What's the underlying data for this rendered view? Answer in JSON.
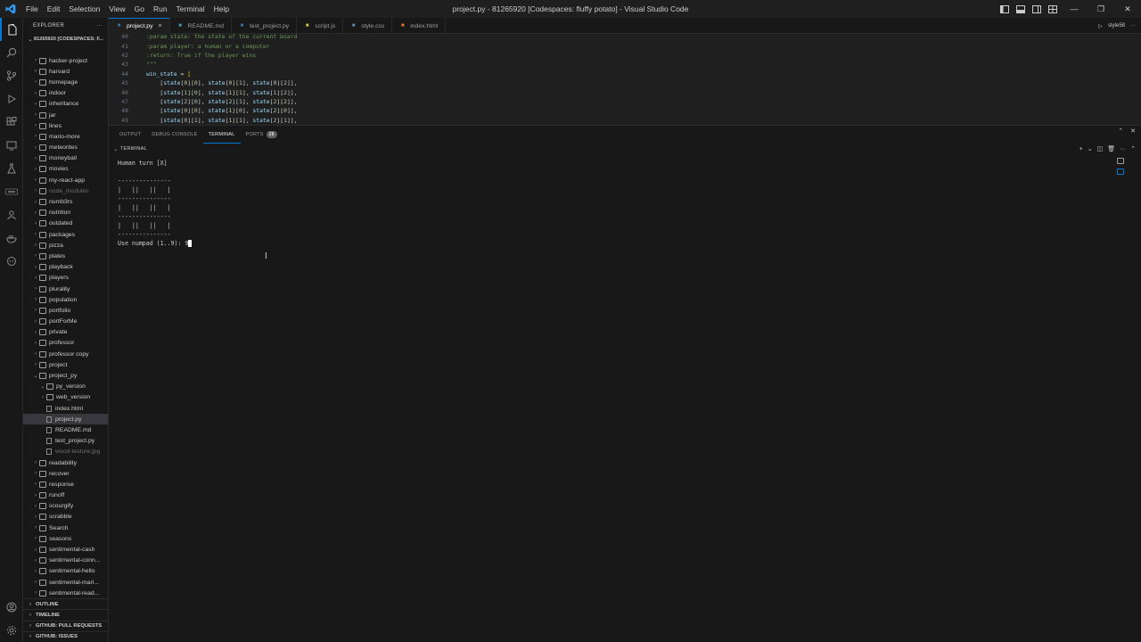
{
  "titlebar": {
    "menu": [
      "File",
      "Edit",
      "Selection",
      "View",
      "Go",
      "Run",
      "Terminal",
      "Help"
    ],
    "title": "project.py - 81265920 [Codespaces: fluffy potato] - Visual Studio Code"
  },
  "sidebar": {
    "header": "EXPLORER",
    "root": "81265920 [CODESPACES: F...",
    "items": [
      {
        "label": "hacker-project",
        "type": "folder",
        "depth": 0,
        "open": false
      },
      {
        "label": "harvard",
        "type": "folder",
        "depth": 0,
        "open": false
      },
      {
        "label": "homepage",
        "type": "folder",
        "depth": 0,
        "open": false
      },
      {
        "label": "indoor",
        "type": "folder",
        "depth": 0,
        "open": false
      },
      {
        "label": "inheritance",
        "type": "folder",
        "depth": 0,
        "open": false
      },
      {
        "label": "jar",
        "type": "folder",
        "depth": 0,
        "open": false
      },
      {
        "label": "lines",
        "type": "folder",
        "depth": 0,
        "open": false
      },
      {
        "label": "mario-more",
        "type": "folder",
        "depth": 0,
        "open": false
      },
      {
        "label": "meteorites",
        "type": "folder",
        "depth": 0,
        "open": false
      },
      {
        "label": "moneyball",
        "type": "folder",
        "depth": 0,
        "open": false
      },
      {
        "label": "movies",
        "type": "folder",
        "depth": 0,
        "open": false
      },
      {
        "label": "my-react-app",
        "type": "folder",
        "depth": 0,
        "open": false
      },
      {
        "label": "node_modules",
        "type": "folder",
        "depth": 0,
        "open": false,
        "muted": true
      },
      {
        "label": "numb3rs",
        "type": "folder",
        "depth": 0,
        "open": false
      },
      {
        "label": "nutrition",
        "type": "folder",
        "depth": 0,
        "open": false
      },
      {
        "label": "outdated",
        "type": "folder",
        "depth": 0,
        "open": false
      },
      {
        "label": "packages",
        "type": "folder",
        "depth": 0,
        "open": false
      },
      {
        "label": "pizza",
        "type": "folder",
        "depth": 0,
        "open": false
      },
      {
        "label": "plates",
        "type": "folder",
        "depth": 0,
        "open": false
      },
      {
        "label": "playback",
        "type": "folder",
        "depth": 0,
        "open": false
      },
      {
        "label": "players",
        "type": "folder",
        "depth": 0,
        "open": false
      },
      {
        "label": "plurality",
        "type": "folder",
        "depth": 0,
        "open": false
      },
      {
        "label": "population",
        "type": "folder",
        "depth": 0,
        "open": false
      },
      {
        "label": "portfolio",
        "type": "folder",
        "depth": 0,
        "open": false
      },
      {
        "label": "portForMe",
        "type": "folder",
        "depth": 0,
        "open": false
      },
      {
        "label": "private",
        "type": "folder",
        "depth": 0,
        "open": false
      },
      {
        "label": "professor",
        "type": "folder",
        "depth": 0,
        "open": false
      },
      {
        "label": "professor copy",
        "type": "folder",
        "depth": 0,
        "open": false
      },
      {
        "label": "project",
        "type": "folder",
        "depth": 0,
        "open": false
      },
      {
        "label": "project_py",
        "type": "folder",
        "depth": 0,
        "open": true
      },
      {
        "label": "py_version",
        "type": "folder",
        "depth": 1,
        "open": true
      },
      {
        "label": "web_version",
        "type": "folder",
        "depth": 1,
        "open": false
      },
      {
        "label": "index.html",
        "type": "file",
        "depth": 1
      },
      {
        "label": "project.py",
        "type": "file",
        "depth": 1,
        "selected": true
      },
      {
        "label": "README.md",
        "type": "file",
        "depth": 1
      },
      {
        "label": "test_project.py",
        "type": "file",
        "depth": 1
      },
      {
        "label": "wood-texture.jpg",
        "type": "file",
        "depth": 1,
        "muted": true
      },
      {
        "label": "readability",
        "type": "folder",
        "depth": 0,
        "open": false
      },
      {
        "label": "recover",
        "type": "folder",
        "depth": 0,
        "open": false
      },
      {
        "label": "response",
        "type": "folder",
        "depth": 0,
        "open": false
      },
      {
        "label": "runoff",
        "type": "folder",
        "depth": 0,
        "open": false
      },
      {
        "label": "scourgify",
        "type": "folder",
        "depth": 0,
        "open": false
      },
      {
        "label": "scrabble",
        "type": "folder",
        "depth": 0,
        "open": false
      },
      {
        "label": "Search",
        "type": "folder",
        "depth": 0,
        "open": false
      },
      {
        "label": "seasons",
        "type": "folder",
        "depth": 0,
        "open": false
      },
      {
        "label": "sentimental-cash",
        "type": "folder",
        "depth": 0,
        "open": false
      },
      {
        "label": "sentimental-conn...",
        "type": "folder",
        "depth": 0,
        "open": false
      },
      {
        "label": "sentimental-hello",
        "type": "folder",
        "depth": 0,
        "open": false
      },
      {
        "label": "sentimental-mari...",
        "type": "folder",
        "depth": 0,
        "open": false
      },
      {
        "label": "sentimental-read...",
        "type": "folder",
        "depth": 0,
        "open": false
      }
    ],
    "sections": [
      "OUTLINE",
      "TIMELINE",
      "GITHUB: PULL REQUESTS",
      "GITHUB: ISSUES"
    ]
  },
  "tabs": [
    {
      "label": "project.py",
      "active": true,
      "icon_color": "#3572a5"
    },
    {
      "label": "README.md",
      "active": false,
      "icon_color": "#519aba"
    },
    {
      "label": "test_project.py",
      "active": false,
      "icon_color": "#3572a5"
    },
    {
      "label": "script.js",
      "active": false,
      "icon_color": "#cbcb41"
    },
    {
      "label": "style.css",
      "active": false,
      "icon_color": "#519aba"
    },
    {
      "label": "index.html",
      "active": false,
      "icon_color": "#e37933"
    }
  ],
  "tabs_right_label": "style58",
  "editor": {
    "lines": [
      {
        "n": "40",
        "text": ":param state: the state of the current board",
        "kind": "comment"
      },
      {
        "n": "41",
        "text": ":param player: a human or a computer",
        "kind": "comment"
      },
      {
        "n": "42",
        "text": ":return: True if the player wins",
        "kind": "comment"
      },
      {
        "n": "43",
        "text": "\"\"\"",
        "kind": "comment"
      },
      {
        "n": "44",
        "text": "win_state = [",
        "kind": "assign"
      },
      {
        "n": "45",
        "text": "    [state[0][0], state[0][1], state[0][2]],",
        "kind": "code"
      },
      {
        "n": "46",
        "text": "    [state[1][0], state[1][1], state[1][2]],",
        "kind": "code"
      },
      {
        "n": "47",
        "text": "    [state[2][0], state[2][1], state[2][2]],",
        "kind": "code"
      },
      {
        "n": "48",
        "text": "    [state[0][0], state[1][0], state[2][0]],",
        "kind": "code"
      },
      {
        "n": "49",
        "text": "    [state[0][1], state[1][1], state[2][1]],",
        "kind": "code"
      }
    ]
  },
  "panel": {
    "tabs": [
      {
        "label": "OUTPUT",
        "active": false
      },
      {
        "label": "DEBUG CONSOLE",
        "active": false
      },
      {
        "label": "TERMINAL",
        "active": true
      },
      {
        "label": "PORTS",
        "active": false,
        "badge": "28"
      }
    ],
    "terminal_header": "TERMINAL",
    "terminal_lines": [
      "Human turn [X]",
      "",
      "---------------",
      "|   ||   ||   |",
      "---------------",
      "|   ||   ||   |",
      "---------------",
      "|   ||   ||   |",
      "---------------"
    ],
    "prompt": "Use numpad (1..9): ",
    "input": "9"
  }
}
